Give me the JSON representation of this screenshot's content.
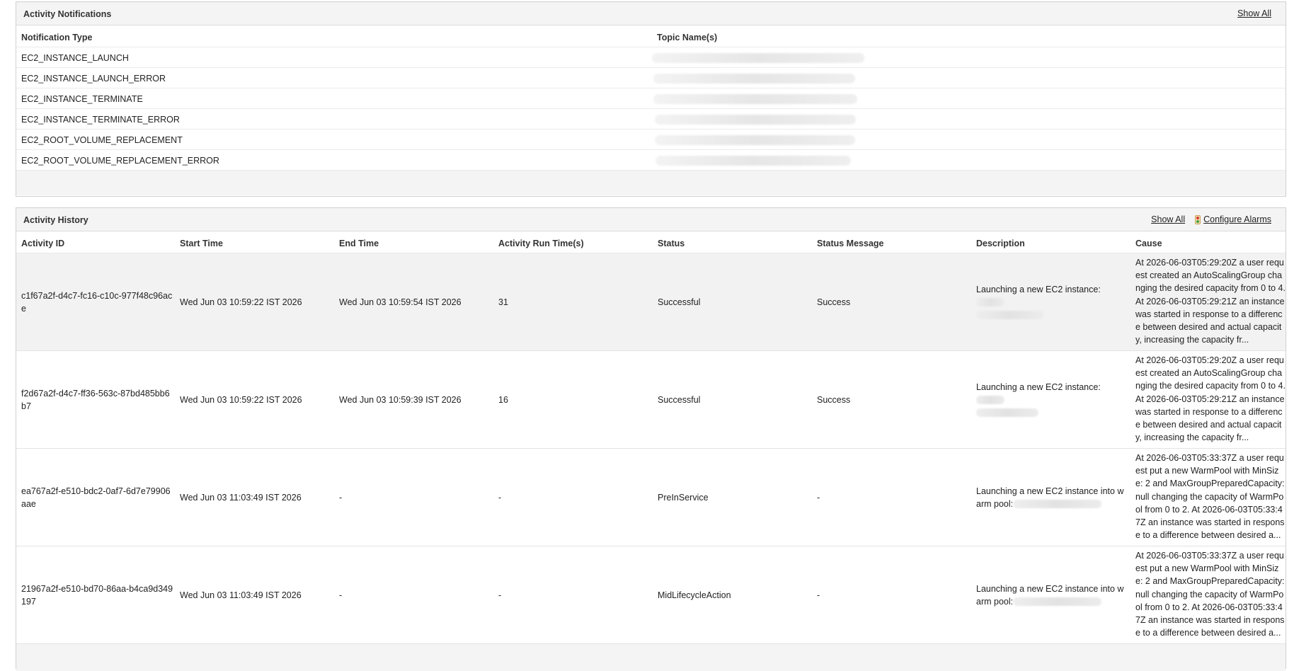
{
  "notifications": {
    "title": "Activity Notifications",
    "show_all": "Show All",
    "columns": {
      "type": "Notification Type",
      "topic": "Topic Name(s)"
    },
    "rows": [
      {
        "type": "EC2_INSTANCE_LAUNCH"
      },
      {
        "type": "EC2_INSTANCE_LAUNCH_ERROR"
      },
      {
        "type": "EC2_INSTANCE_TERMINATE"
      },
      {
        "type": "EC2_INSTANCE_TERMINATE_ERROR"
      },
      {
        "type": "EC2_ROOT_VOLUME_REPLACEMENT"
      },
      {
        "type": "EC2_ROOT_VOLUME_REPLACEMENT_ERROR"
      }
    ]
  },
  "history": {
    "title": "Activity History",
    "show_all": "Show All",
    "configure_alarms": "Configure Alarms",
    "columns": {
      "id": "Activity ID",
      "start": "Start Time",
      "end": "End Time",
      "run": "Activity Run Time(s)",
      "status": "Status",
      "msg": "Status Message",
      "desc": "Description",
      "cause": "Cause"
    },
    "rows": [
      {
        "id": "c1f67a2f-d4c7-fc16-c10c-977f48c96ace",
        "start": "Wed Jun 03 10:59:22 IST 2026",
        "end": "Wed Jun 03 10:59:54 IST 2026",
        "run": "31",
        "status": "Successful",
        "msg": "Success",
        "desc": "Launching a new EC2 instance:",
        "cause": "At 2026-06-03T05:29:20Z a user request created an AutoScalingGroup changing the desired capacity from 0 to 4. At 2026-06-03T05:29:21Z an instance was started in response to a difference between desired and actual capacity, increasing the capacity fr..."
      },
      {
        "id": "f2d67a2f-d4c7-ff36-563c-87bd485bb6b7",
        "start": "Wed Jun 03 10:59:22 IST 2026",
        "end": "Wed Jun 03 10:59:39 IST 2026",
        "run": "16",
        "status": "Successful",
        "msg": "Success",
        "desc": "Launching a new EC2 instance:",
        "cause": "At 2026-06-03T05:29:20Z a user request created an AutoScalingGroup changing the desired capacity from 0 to 4. At 2026-06-03T05:29:21Z an instance was started in response to a difference between desired and actual capacity, increasing the capacity fr..."
      },
      {
        "id": "ea767a2f-e510-bdc2-0af7-6d7e79906aae",
        "start": "Wed Jun 03 11:03:49 IST 2026",
        "end": "-",
        "run": "-",
        "status": "PreInService",
        "msg": "-",
        "desc": "Launching a new EC2 instance into warm pool:",
        "cause": "At 2026-06-03T05:33:37Z a user request put a new WarmPool with MinSize: 2 and MaxGroupPreparedCapacity: null changing the capacity of WarmPool from 0 to 2. At 2026-06-03T05:33:47Z an instance was started in response to a difference between desired a..."
      },
      {
        "id": "21967a2f-e510-bd70-86aa-b4ca9d349197",
        "start": "Wed Jun 03 11:03:49 IST 2026",
        "end": "-",
        "run": "-",
        "status": "MidLifecycleAction",
        "msg": "-",
        "desc": "Launching a new EC2 instance into warm pool:",
        "cause": "At 2026-06-03T05:33:37Z a user request put a new WarmPool with MinSize: 2 and MaxGroupPreparedCapacity: null changing the capacity of WarmPool from 0 to 2. At 2026-06-03T05:33:47Z an instance was started in response to a difference between desired a..."
      }
    ]
  }
}
